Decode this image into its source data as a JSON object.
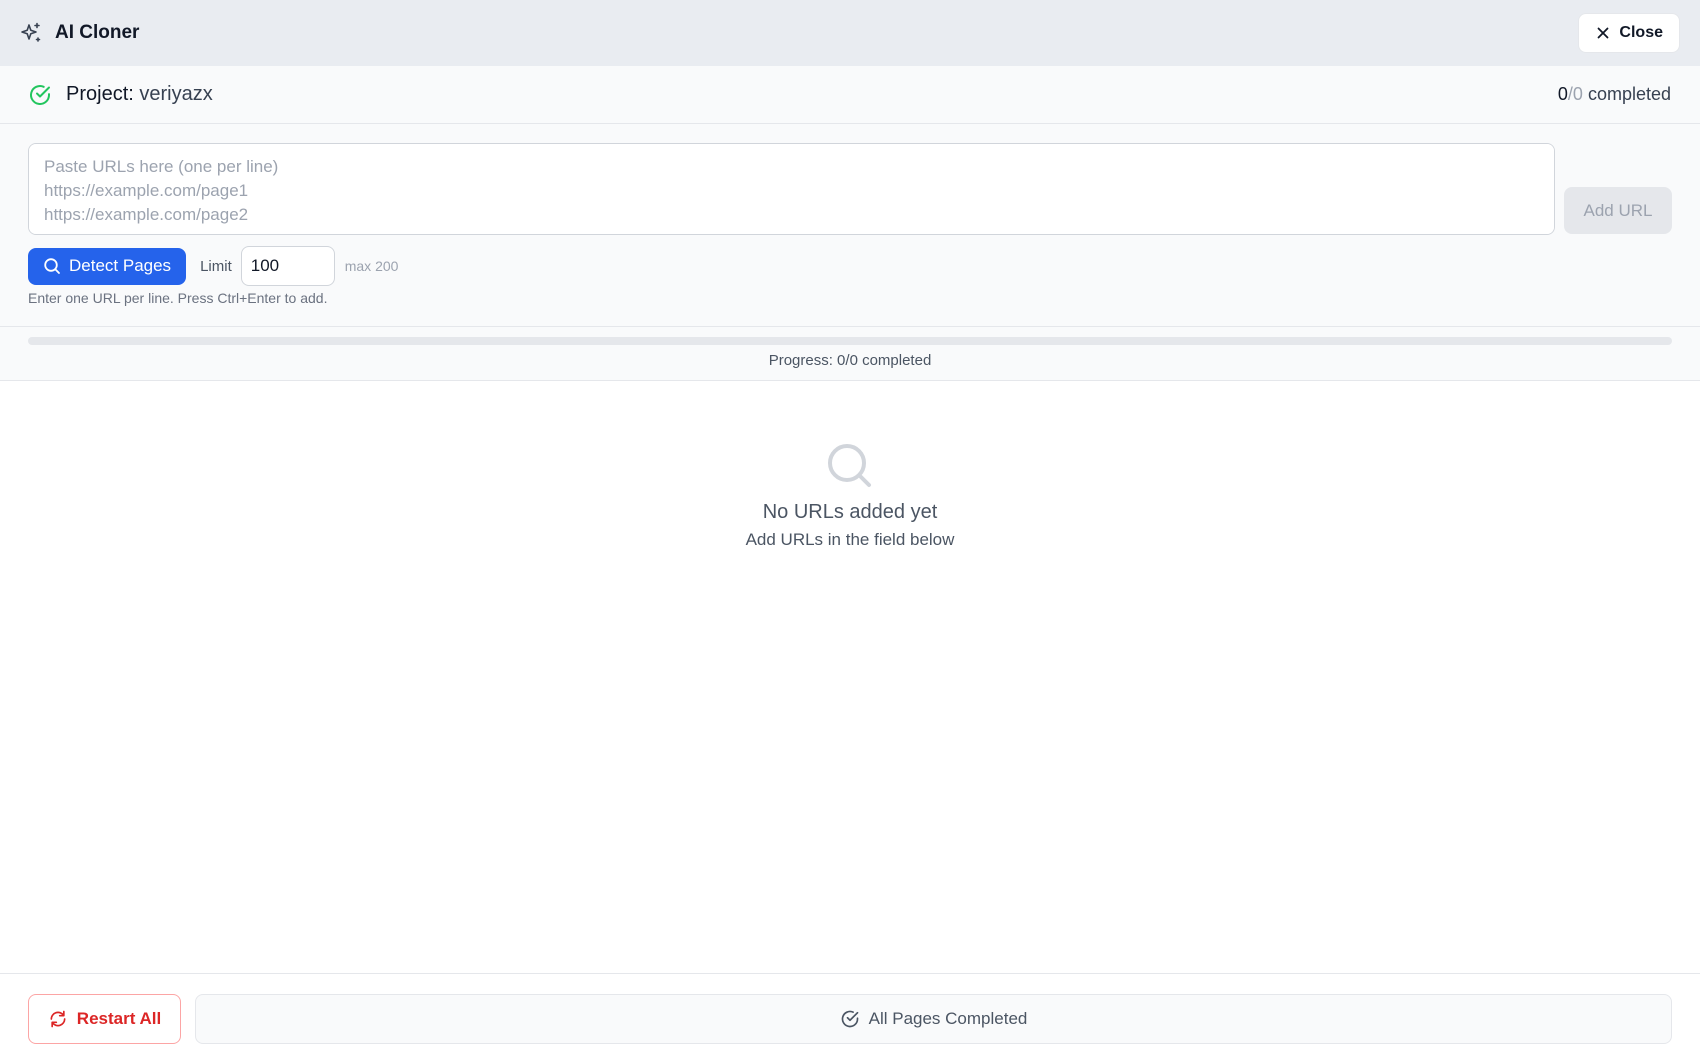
{
  "header": {
    "title": "AI Cloner",
    "close_label": "Close",
    "brand_icon": "sparkles-icon"
  },
  "project": {
    "label": "Project:",
    "name": "veriyazx",
    "status_icon": "check-circle-icon",
    "status_color": "#22c55e",
    "completed_count": "0",
    "separator": "/",
    "total_count": "0",
    "completed_suffix": " completed"
  },
  "url_input": {
    "placeholder": "Paste URLs here (one per line)\nhttps://example.com/page1\nhttps://example.com/page2",
    "add_label": "Add URL",
    "detect_label": "Detect Pages",
    "limit_label": "Limit",
    "limit_value": "100",
    "max_label": "max 200",
    "hint": "Enter one URL per line. Press Ctrl+Enter to add."
  },
  "progress": {
    "text": "Progress: 0/0 completed",
    "fraction": 0
  },
  "empty_state": {
    "icon": "search-icon",
    "title": "No URLs added yet",
    "subtitle": "Add URLs in the field below"
  },
  "footer": {
    "restart_label": "Restart All",
    "completed_label": "All Pages Completed"
  },
  "colors": {
    "accent": "#2563eb",
    "danger": "#dc2626",
    "success": "#22c55e"
  }
}
